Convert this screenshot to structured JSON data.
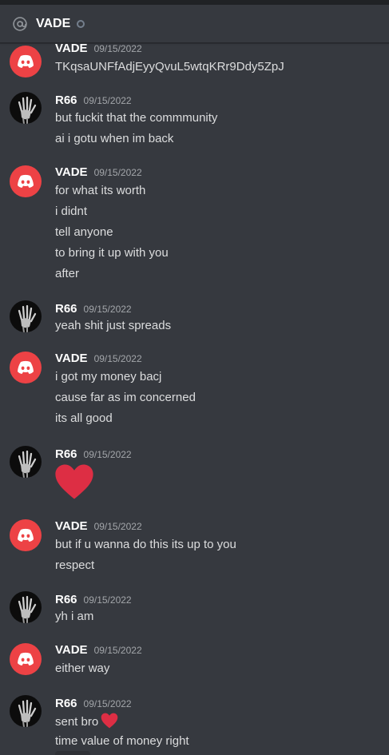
{
  "header": {
    "title": "VADE",
    "icon": "at-icon",
    "status": "offline"
  },
  "colors": {
    "background": "#36393f",
    "discord_red": "#ed4245",
    "heart": "#dd2e44",
    "username": "#ffffff",
    "text": "#dcddde",
    "timestamp": "#a3a6aa"
  },
  "messages": [
    {
      "user": "VADE",
      "time": "09/15/2022",
      "lines": [
        "TKqsaUNFfAdjEyyQvuL5wtqKRr9Ddy5ZpJ"
      ]
    },
    {
      "user": "R66",
      "time": "09/15/2022",
      "lines": [
        "but fuckit that the commmunity",
        "ai i gotu when im back"
      ]
    },
    {
      "user": "VADE",
      "time": "09/15/2022",
      "lines": [
        "for what its worth",
        "i didnt",
        "tell anyone",
        "to bring it up with you",
        "after"
      ]
    },
    {
      "user": "R66",
      "time": "09/15/2022",
      "lines": [
        "yeah shit just spreads"
      ]
    },
    {
      "user": "VADE",
      "time": "09/15/2022",
      "lines": [
        "i got my money bacj",
        "cause far as im concerned",
        "its all good"
      ]
    },
    {
      "user": "R66",
      "time": "09/15/2022",
      "lines": [],
      "emoji": "heart"
    },
    {
      "user": "VADE",
      "time": "09/15/2022",
      "lines": [
        "but if u wanna do this its up to you",
        "respect"
      ]
    },
    {
      "user": "R66",
      "time": "09/15/2022",
      "lines": [
        "yh i am"
      ]
    },
    {
      "user": "VADE",
      "time": "09/15/2022",
      "lines": [
        "either way"
      ]
    },
    {
      "user": "R66",
      "time": "09/15/2022",
      "lines": [
        "sent bro",
        "time value of money right"
      ],
      "inline_emoji": "heart"
    }
  ]
}
